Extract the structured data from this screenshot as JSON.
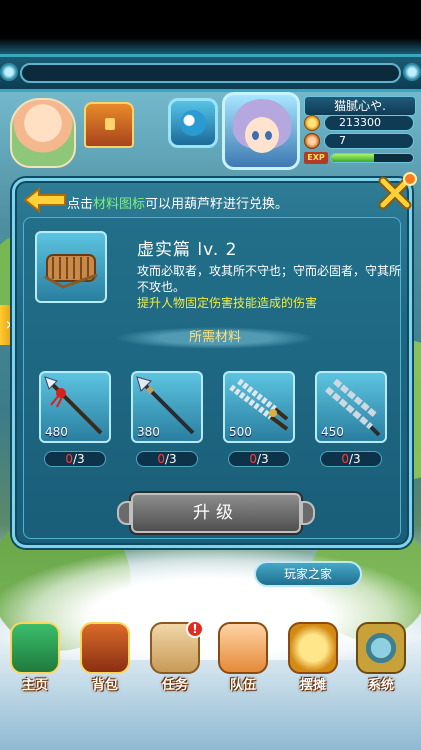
{
  "player": {
    "name": "猫腻心や.",
    "coins": "213300",
    "ingots": "7",
    "exp_label": "EXP",
    "exp_progress": 0.52
  },
  "dialog": {
    "hint_prefix": "点击",
    "hint_highlight": "材料图标",
    "hint_suffix": "可以用葫芦籽进行兑换。",
    "item": {
      "title": "虚实篇 lv. 2",
      "description": "攻而必取者，攻其所不守也；守而必固者，守其所不攻也。",
      "effect": "提升人物固定伤害技能造成的伤害"
    },
    "materials_header": "所需材料",
    "materials": [
      {
        "name": "red-tassel-spear",
        "price": "480",
        "have": "0",
        "need": "/3"
      },
      {
        "name": "steel-spear",
        "price": "380",
        "have": "0",
        "need": "/3"
      },
      {
        "name": "serrated-twin-blades",
        "price": "500",
        "have": "0",
        "need": "/3"
      },
      {
        "name": "jointed-iron-whip",
        "price": "450",
        "have": "0",
        "need": "/3"
      }
    ],
    "upgrade_label": "升级"
  },
  "community_banner": "玩家之家",
  "side_tab_arrow": "›",
  "bottom_nav": [
    {
      "label": "主页",
      "icon": "home-icon"
    },
    {
      "label": "背包",
      "icon": "chest-bag-icon"
    },
    {
      "label": "任务",
      "icon": "scroll-quest-icon",
      "badge": "!"
    },
    {
      "label": "队伍",
      "icon": "team-icon"
    },
    {
      "label": "摆摊",
      "icon": "coin-stall-icon"
    },
    {
      "label": "系统",
      "icon": "gear-icon"
    }
  ],
  "colors": {
    "highlight_green": "#7ff07a",
    "effect_yellow": "#f2ee3a",
    "missing_red": "#ff3b3b",
    "panel_teal": "#1e6681"
  }
}
